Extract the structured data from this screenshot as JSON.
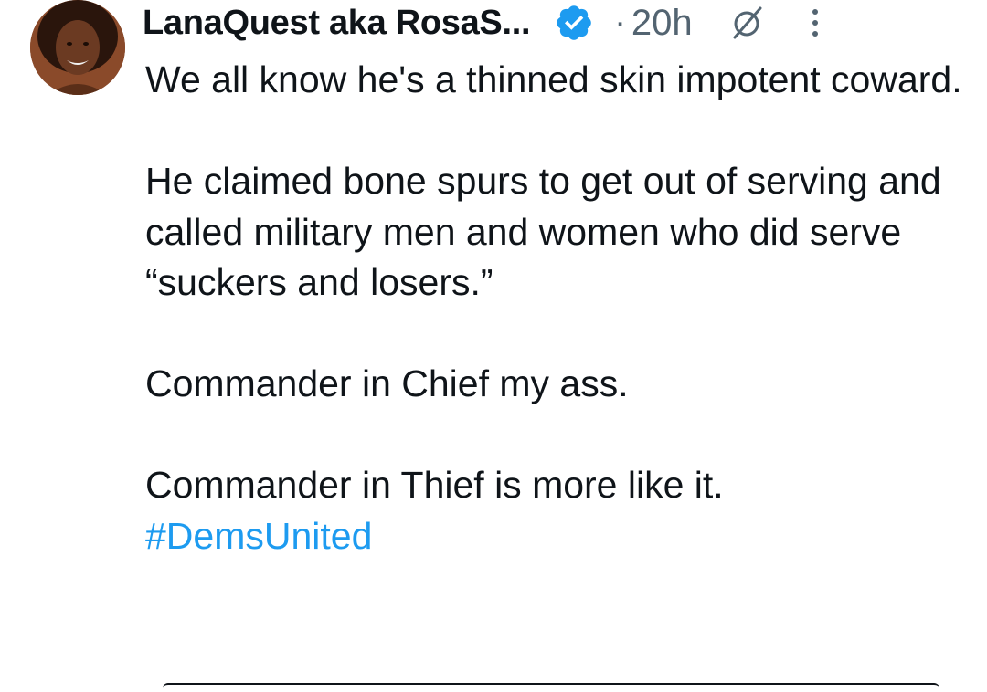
{
  "tweet": {
    "author": {
      "display_name": "LanaQuest aka RosaS...",
      "verified_icon": "verified-badge-icon",
      "avatar": "avatar-photo"
    },
    "separator": "·",
    "timestamp": "20h",
    "grok_icon": "grok-icon",
    "more_icon": "more-vertical-icon",
    "paragraphs": [
      "We all know he's a thinned skin impotent coward.",
      "He claimed bone spurs to get out of serving and called military men and women who did serve “suckers and losers.”",
      "Commander in Chief my ass.",
      "Commander in Thief is more like it."
    ],
    "hashtag": "#DemsUnited"
  },
  "colors": {
    "text": "#0f1419",
    "muted": "#536471",
    "link": "#1d9bf0",
    "verified": "#1d9bf0"
  }
}
